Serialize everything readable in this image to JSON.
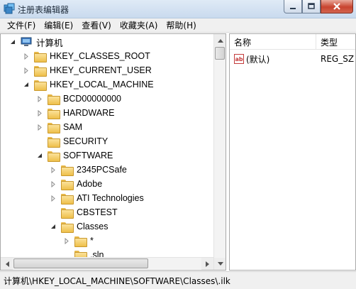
{
  "window": {
    "title": "注册表编辑器",
    "minimize_icon": "minimize-icon",
    "maximize_icon": "maximize-icon",
    "close_icon": "close-icon"
  },
  "menu": [
    "文件(F)",
    "编辑(E)",
    "查看(V)",
    "收藏夹(A)",
    "帮助(H)"
  ],
  "tree": [
    {
      "label": "计算机",
      "depth": 0,
      "state": "expanded",
      "icon": "computer-icon"
    },
    {
      "label": "HKEY_CLASSES_ROOT",
      "depth": 1,
      "state": "collapsed",
      "icon": "folder-icon"
    },
    {
      "label": "HKEY_CURRENT_USER",
      "depth": 1,
      "state": "collapsed",
      "icon": "folder-icon"
    },
    {
      "label": "HKEY_LOCAL_MACHINE",
      "depth": 1,
      "state": "expanded",
      "icon": "folder-icon"
    },
    {
      "label": "BCD00000000",
      "depth": 2,
      "state": "collapsed",
      "icon": "folder-icon"
    },
    {
      "label": "HARDWARE",
      "depth": 2,
      "state": "collapsed",
      "icon": "folder-icon"
    },
    {
      "label": "SAM",
      "depth": 2,
      "state": "collapsed",
      "icon": "folder-icon"
    },
    {
      "label": "SECURITY",
      "depth": 2,
      "state": "none",
      "icon": "folder-icon"
    },
    {
      "label": "SOFTWARE",
      "depth": 2,
      "state": "expanded",
      "icon": "folder-icon"
    },
    {
      "label": "2345PCSafe",
      "depth": 3,
      "state": "collapsed",
      "icon": "folder-icon"
    },
    {
      "label": "Adobe",
      "depth": 3,
      "state": "collapsed",
      "icon": "folder-icon"
    },
    {
      "label": "ATI Technologies",
      "depth": 3,
      "state": "collapsed",
      "icon": "folder-icon"
    },
    {
      "label": "CBSTEST",
      "depth": 3,
      "state": "none",
      "icon": "folder-icon"
    },
    {
      "label": "Classes",
      "depth": 3,
      "state": "expanded",
      "icon": "folder-icon"
    },
    {
      "label": "*",
      "depth": 4,
      "state": "collapsed",
      "icon": "folder-icon"
    },
    {
      "label": ".sln",
      "depth": 4,
      "state": "none",
      "icon": "folder-icon"
    }
  ],
  "list": {
    "columns": [
      "名称",
      "类型"
    ],
    "rows": [
      {
        "name": "(默认)",
        "type": "REG_SZ",
        "icon": "string-value-icon"
      }
    ]
  },
  "status": "计算机\\HKEY_LOCAL_MACHINE\\SOFTWARE\\Classes\\.ilk"
}
